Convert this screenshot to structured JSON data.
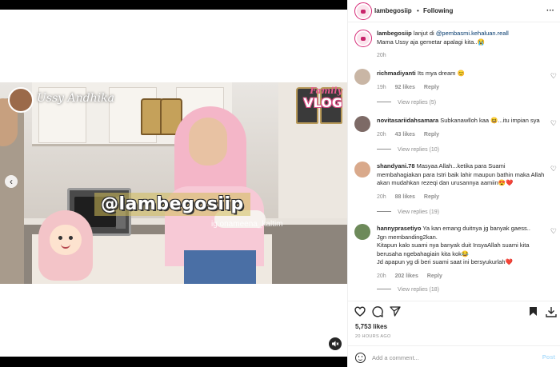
{
  "video": {
    "overlay_tag": "@lambegosiip",
    "brand_name": "Ussy Andhika",
    "vlog_family": "Family",
    "vlog_label": "VLOG",
    "watermark": "ig.onameena_kaltim"
  },
  "header": {
    "username": "lambegosiip",
    "separator": "•",
    "follow_status": "Following",
    "more_icon": "more-horizontal-icon"
  },
  "caption": {
    "username": "lambegosiip",
    "text_before": "lanjut di",
    "mention": "@pembasmi.kehaluan.reall",
    "line2": "Mama Ussy aja gemetar apalagi kita..😭",
    "time": "20h"
  },
  "comments": [
    {
      "username": "richmadiyanti",
      "text": "Its mya dream 😊",
      "time": "19h",
      "likes": "92 likes",
      "reply": "Reply",
      "view_replies": "View replies (5)",
      "avatar_color": "#c9b6a5"
    },
    {
      "username": "novitasariidahsamara",
      "text": "Subkanawlloh kaa 😆...itu impian sya",
      "time": "20h",
      "likes": "43 likes",
      "reply": "Reply",
      "view_replies": "View replies (10)",
      "avatar_color": "#7d6a66"
    },
    {
      "username": "shandyani.78",
      "text": "Masyaa Allah...ketika para Suami membahagiakan para Istri baik lahir maupun bathin maka Allah akan mudahkan rezeqi dan urusannya aamiin😍❤️",
      "time": "20h",
      "likes": "88 likes",
      "reply": "Reply",
      "view_replies": "View replies (19)",
      "avatar_color": "#d9a98b"
    },
    {
      "username": "hannyprasetiyo",
      "text_lines": [
        "Ya kan emang duitnya jg banyak gaess..",
        "Jgn membanding2kan.",
        "Kitapun kalo suami nya banyak duit InsyaAllah suami kita berusaha ngebahagiain kita kok😂",
        "Jd apapun yg di beri suami saat ini bersyukurlah❤️"
      ],
      "time": "20h",
      "likes": "202 likes",
      "reply": "Reply",
      "view_replies": "View replies (18)",
      "avatar_color": "#6d8a5a"
    }
  ],
  "actions": {
    "like_icon": "heart-icon",
    "comment_icon": "comment-icon",
    "share_icon": "share-icon",
    "save_icon": "bookmark-icon",
    "download_icon": "download-icon"
  },
  "stats": {
    "likes": "5,753 likes",
    "time_ago": "20 HOURS AGO"
  },
  "add_comment": {
    "placeholder": "Add a comment...",
    "post_label": "Post"
  }
}
